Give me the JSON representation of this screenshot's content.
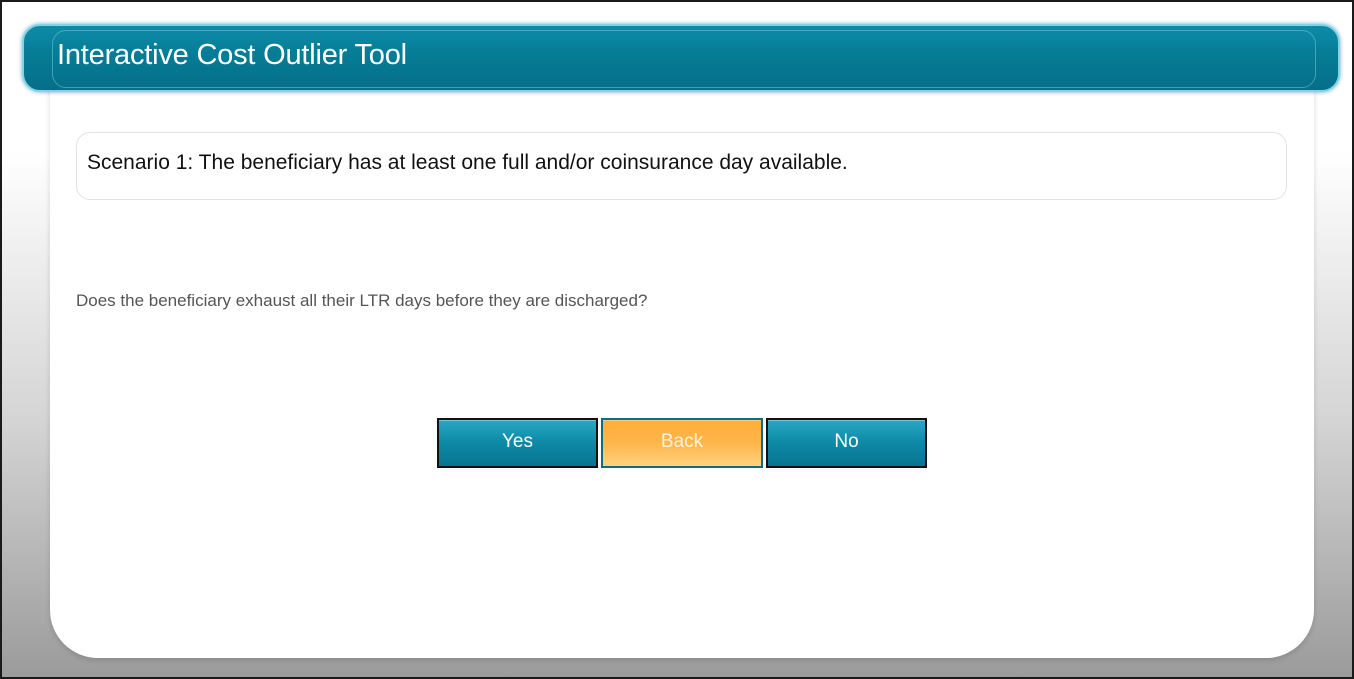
{
  "header": {
    "title": "Interactive Cost Outlier Tool"
  },
  "scenario": {
    "text": "Scenario 1: The beneficiary has at least one full and/or coinsurance day available."
  },
  "question": {
    "text": "Does the beneficiary exhaust all their LTR days before they are discharged?"
  },
  "buttons": {
    "yes_label": "Yes",
    "back_label": "Back",
    "no_label": "No"
  },
  "colors": {
    "title_bar": "#067c96",
    "button_teal": "#0d89a6",
    "button_orange": "#ffb64a"
  }
}
